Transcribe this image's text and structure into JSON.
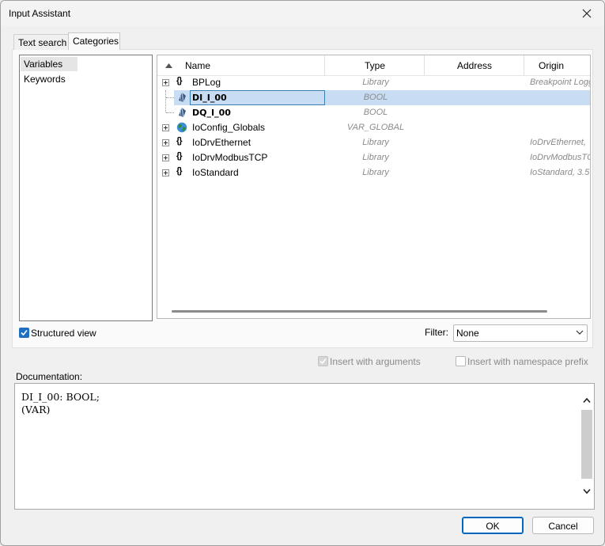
{
  "window": {
    "title": "Input Assistant"
  },
  "tabs": [
    {
      "label": "Text search",
      "active": false
    },
    {
      "label": "Categories",
      "active": true
    }
  ],
  "categories": [
    {
      "label": "Variables",
      "selected": true
    },
    {
      "label": "Keywords",
      "selected": false
    }
  ],
  "tree": {
    "columns": {
      "name": "Name",
      "type": "Type",
      "address": "Address",
      "origin": "Origin"
    },
    "sort_indicator": "sort-up-icon",
    "rows": [
      {
        "name": "BPLog",
        "type": "Library",
        "origin": "Breakpoint Logg",
        "icon": "library-icon",
        "expandable": true,
        "bold": false
      },
      {
        "name": "DI_I_00",
        "type": "BOOL",
        "origin": "",
        "icon": "variable-icon",
        "expandable": false,
        "bold": true,
        "selected": true
      },
      {
        "name": "DQ_I_00",
        "type": "BOOL",
        "origin": "",
        "icon": "variable-icon",
        "expandable": false,
        "bold": true
      },
      {
        "name": "IoConfig_Globals",
        "type": "VAR_GLOBAL",
        "origin": "",
        "icon": "globe-icon",
        "expandable": true,
        "bold": false
      },
      {
        "name": "IoDrvEthernet",
        "type": "Library",
        "origin": "IoDrvEthernet,",
        "icon": "library-icon",
        "expandable": true,
        "bold": false
      },
      {
        "name": "IoDrvModbusTCP",
        "type": "Library",
        "origin": "IoDrvModbusTC",
        "icon": "library-icon",
        "expandable": true,
        "bold": false
      },
      {
        "name": "IoStandard",
        "type": "Library",
        "origin": "IoStandard, 3.5",
        "icon": "library-icon",
        "expandable": true,
        "bold": false
      }
    ]
  },
  "options": {
    "structured_view": {
      "label": "Structured view",
      "checked": true
    },
    "filter_label": "Filter:",
    "filter_value": "None",
    "insert_with_arguments": {
      "label": "Insert with arguments",
      "checked": true,
      "disabled": true
    },
    "insert_with_namespace_prefix": {
      "label": "Insert with namespace prefix",
      "checked": false,
      "disabled": true
    }
  },
  "documentation": {
    "label": "Documentation:",
    "line1": "DI_I_00: BOOL;",
    "line2": "(VAR)"
  },
  "buttons": {
    "ok": "OK",
    "cancel": "Cancel"
  },
  "colors": {
    "selection": "#c8ddf3",
    "accent": "#1f6fc1",
    "globe": "#2e8b3e"
  }
}
